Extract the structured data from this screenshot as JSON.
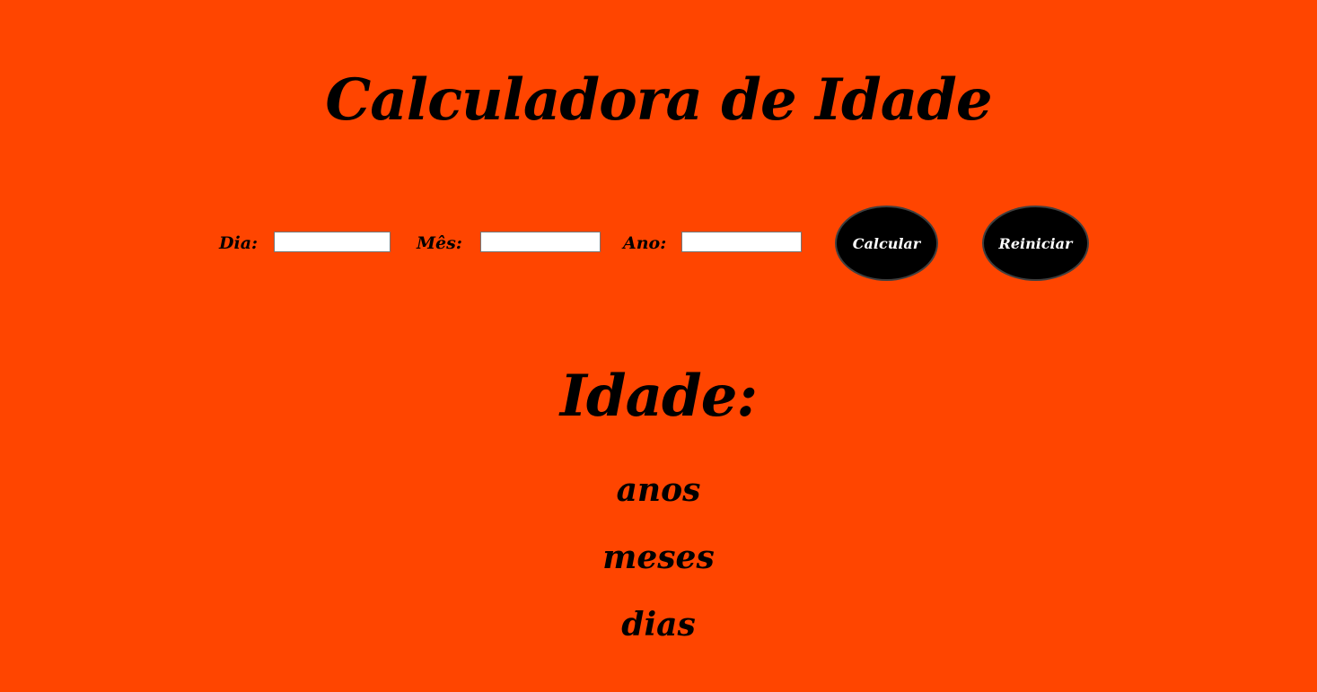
{
  "app": {
    "title": "Calculadora de Idade",
    "background_color": "#ff4500"
  },
  "form": {
    "day_label": "Dia:",
    "day_value": "",
    "month_label": "Mês:",
    "month_value": "",
    "year_label": "Ano:",
    "year_value": "",
    "calculate_label": "Calcular",
    "reset_label": "Reiniciar"
  },
  "result": {
    "heading": "Idade:",
    "years": "anos",
    "months": "meses",
    "days": "dias"
  }
}
